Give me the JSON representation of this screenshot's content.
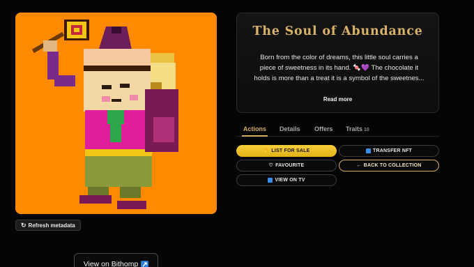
{
  "nft": {
    "title": "The Soul of Abundance",
    "description_lines": [
      "Born from the color of dreams, this little soul carries a",
      "piece of sweetness in its hand. 🍬💜 The chocolate it",
      "holds is more than a treat it is a symbol of the sweetnes..."
    ],
    "read_more": "Read more",
    "artwork_background": "#ff8a00"
  },
  "left": {
    "refresh_label": "Refresh metadata",
    "refresh_icon": "refresh-icon",
    "bithomp_label": "View on Bithomp",
    "bithomp_icon": "external-link-icon"
  },
  "tabs": [
    {
      "label": "Actions",
      "active": true
    },
    {
      "label": "Details"
    },
    {
      "label": "Offers"
    },
    {
      "label": "Traits",
      "count": "10"
    }
  ],
  "actions": {
    "list_for_sale": {
      "icon": "✋",
      "label": "LIST FOR SALE"
    },
    "transfer_nft": {
      "icon": "transfer-icon",
      "label": "TRANSFER NFT"
    },
    "favourite": {
      "icon": "♡",
      "label": "FAVOURITE"
    },
    "back_to_collection": {
      "icon": "←",
      "label": "BACK TO COLLECTION"
    },
    "view_on_tv": {
      "icon": "tv-icon",
      "label": "VIEW ON TV"
    }
  },
  "colors": {
    "accent_gold": "#d4ad62",
    "button_yellow": "#f7cf3b",
    "background": "#050505"
  }
}
